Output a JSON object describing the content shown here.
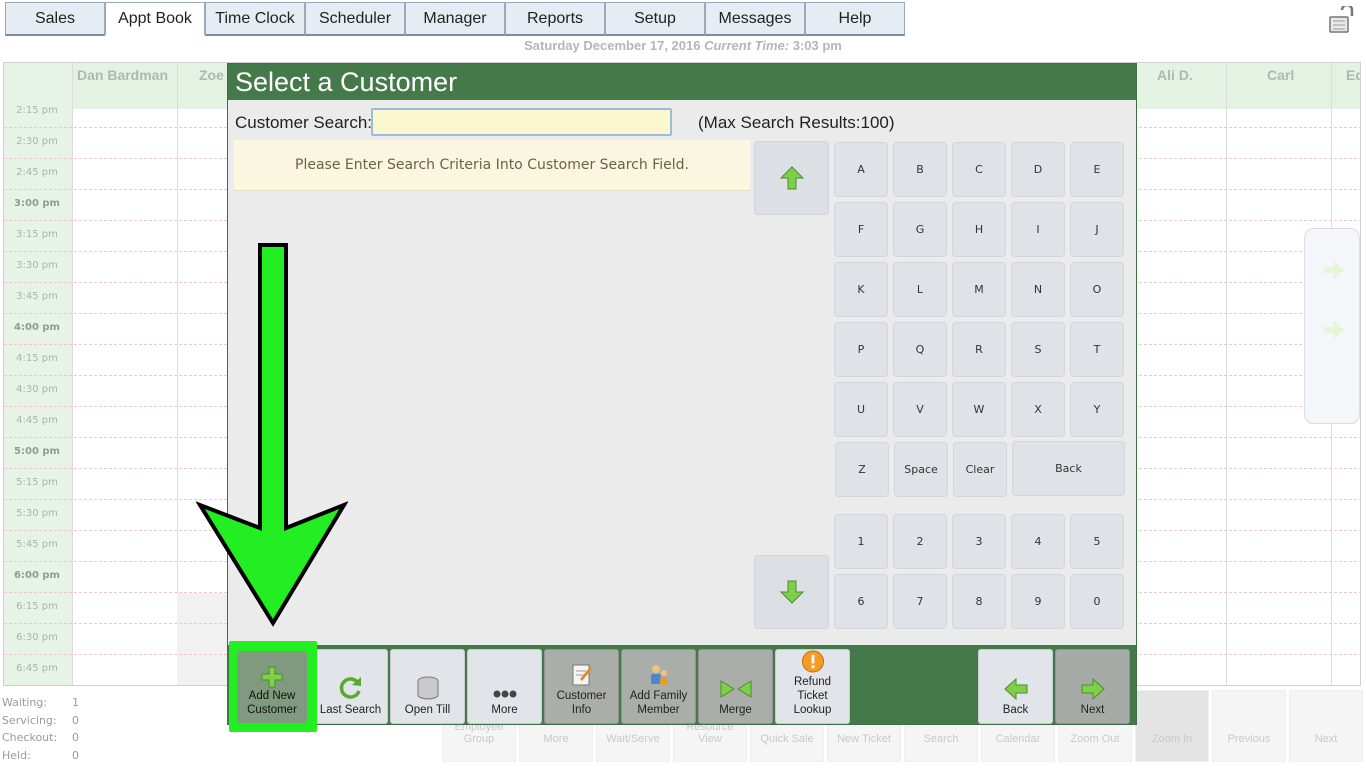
{
  "nav": {
    "tabs": [
      "Sales",
      "Appt Book",
      "Time Clock",
      "Scheduler",
      "Manager",
      "Reports",
      "Setup",
      "Messages",
      "Help"
    ],
    "active": "Appt Book",
    "lock_icon": "lock-open-icon"
  },
  "datebar": {
    "date": "Saturday December 17, 2016",
    "current_label": "Current Time:",
    "time": "3:03 pm"
  },
  "book": {
    "columns": [
      "Dan Bardman",
      "Zoe",
      "Ali D.",
      "Carl",
      "Ed"
    ],
    "times": [
      "2:15 pm",
      "2:30 pm",
      "2:45 pm",
      "3:00 pm",
      "3:15 pm",
      "3:30 pm",
      "3:45 pm",
      "4:00 pm",
      "4:15 pm",
      "4:30 pm",
      "4:45 pm",
      "5:00 pm",
      "5:15 pm",
      "5:30 pm",
      "5:45 pm",
      "6:00 pm",
      "6:15 pm",
      "6:30 pm",
      "6:45 pm"
    ]
  },
  "status": [
    {
      "label": "Waiting:",
      "value": "1"
    },
    {
      "label": "Servicing:",
      "value": "0"
    },
    {
      "label": "Checkout:",
      "value": "0"
    },
    {
      "label": "Held:",
      "value": "0"
    }
  ],
  "bg_buttons": [
    "Employee Group",
    "More",
    "Wait/Serve",
    "Resource View",
    "Quick Sale",
    "New Ticket",
    "Search",
    "Calendar",
    "Zoom Out",
    "Zoom In",
    "Previous",
    "Next"
  ],
  "modal": {
    "title": "Select a Customer",
    "search_label": "Customer Search:",
    "search_value": "",
    "max_results": "(Max Search Results:100)",
    "message": "Please Enter Search Criteria Into Customer Search Field.",
    "keys": [
      "A",
      "B",
      "C",
      "D",
      "E",
      "F",
      "G",
      "H",
      "I",
      "J",
      "K",
      "L",
      "M",
      "N",
      "O",
      "P",
      "Q",
      "R",
      "S",
      "T",
      "U",
      "V",
      "W",
      "X",
      "Y"
    ],
    "key_z": "Z",
    "key_space": "Space",
    "key_clear": "Clear",
    "key_back": "Back",
    "digits_row1": [
      "1",
      "2",
      "3",
      "4",
      "5"
    ],
    "digits_row2": [
      "6",
      "7",
      "8",
      "9",
      "0"
    ]
  },
  "footer": {
    "add_new_line1": "Add New",
    "add_new_line2": "Customer",
    "last_search": "Last Search",
    "open_till": "Open Till",
    "more": "More",
    "customer_info_1": "Customer",
    "customer_info_2": "Info",
    "add_family_1": "Add Family",
    "add_family_2": "Member",
    "merge": "Merge",
    "refund_1": "Refund",
    "refund_2": "Ticket",
    "refund_3": "Lookup",
    "back": "Back",
    "next": "Next"
  },
  "colors": {
    "modal_green": "#447a4a",
    "highlight_green": "#22ee22",
    "search_bg": "#fbf7cf"
  }
}
